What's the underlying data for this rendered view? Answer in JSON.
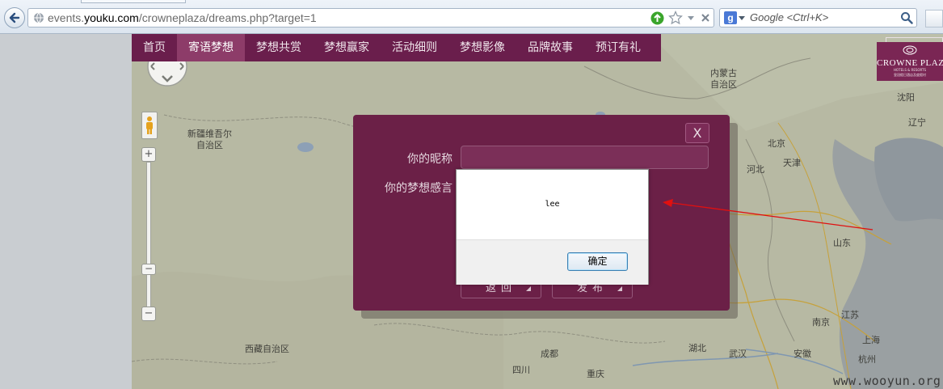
{
  "browser": {
    "url_prefix": "events.",
    "url_domain": "youku.com",
    "url_path": "/crowneplaza/dreams.php?target=1",
    "search_placeholder": "Google <Ctrl+K>",
    "search_engine_letter": "g"
  },
  "nav": {
    "items": [
      "首页",
      "寄语梦想",
      "梦想共赏",
      "梦想赢家",
      "活动细则",
      "梦想影像",
      "品牌故事",
      "预订有礼"
    ],
    "active_index": 1
  },
  "brand": {
    "name": "CROWNE PLAZ",
    "tagline": "HOTELS & RESORTS",
    "tagline_cn": "皇冠假日酒店及度假村",
    "color": "#6b2047"
  },
  "map": {
    "labels": [
      {
        "text": "内蒙古\n自治区"
      },
      {
        "text": "新疆维吾尔\n自治区"
      },
      {
        "text": "沈阳"
      },
      {
        "text": "辽宁"
      },
      {
        "text": "北京"
      },
      {
        "text": "天津"
      },
      {
        "text": "河北"
      },
      {
        "text": "山东"
      },
      {
        "text": "江苏"
      },
      {
        "text": "南京"
      },
      {
        "text": "上海"
      },
      {
        "text": "西藏自治区"
      },
      {
        "text": "成都"
      },
      {
        "text": "四川"
      },
      {
        "text": "湖北"
      },
      {
        "text": "武汉"
      },
      {
        "text": "安徽"
      },
      {
        "text": "杭州"
      },
      {
        "text": "重庆"
      }
    ],
    "zoom_in": "+",
    "zoom_out": "−",
    "zoom_thumb": "−"
  },
  "dialog": {
    "close_label": "X",
    "nickname_label": "你的昵称",
    "nickname_value": "",
    "message_label": "你的梦想感言",
    "back_label": "返回",
    "submit_label": "发布"
  },
  "alert": {
    "message": "lee",
    "ok_label": "确定"
  },
  "watermark": "www.wooyun.org",
  "colors": {
    "accent_red": "#e01010",
    "nav_bg": "#6a1e4c",
    "nav_active": "#8d3c69"
  }
}
